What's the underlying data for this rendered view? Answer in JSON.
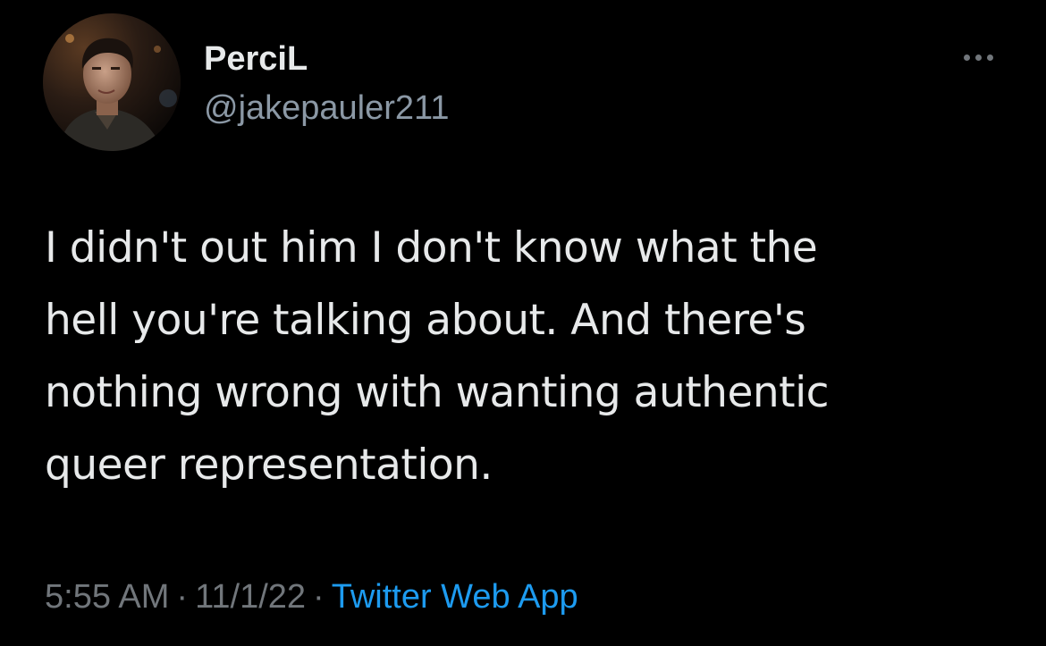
{
  "author": {
    "display_name": "PerciL",
    "handle": "@jakepauler211",
    "avatar_icon": "profile-photo"
  },
  "more_icon": "more-dots-icon",
  "tweet": {
    "lines": [
      "I didn't out him I don't know what the",
      "hell you're talking about. And there's",
      "nothing wrong with wanting authentic",
      "queer representation."
    ]
  },
  "meta": {
    "time": "5:55 AM",
    "separator": "·",
    "date": "11/1/22",
    "source": "Twitter Web App"
  },
  "colors": {
    "background": "#000000",
    "text": "#e7e9ea",
    "secondary": "#71767b",
    "link": "#1d9bf0"
  }
}
